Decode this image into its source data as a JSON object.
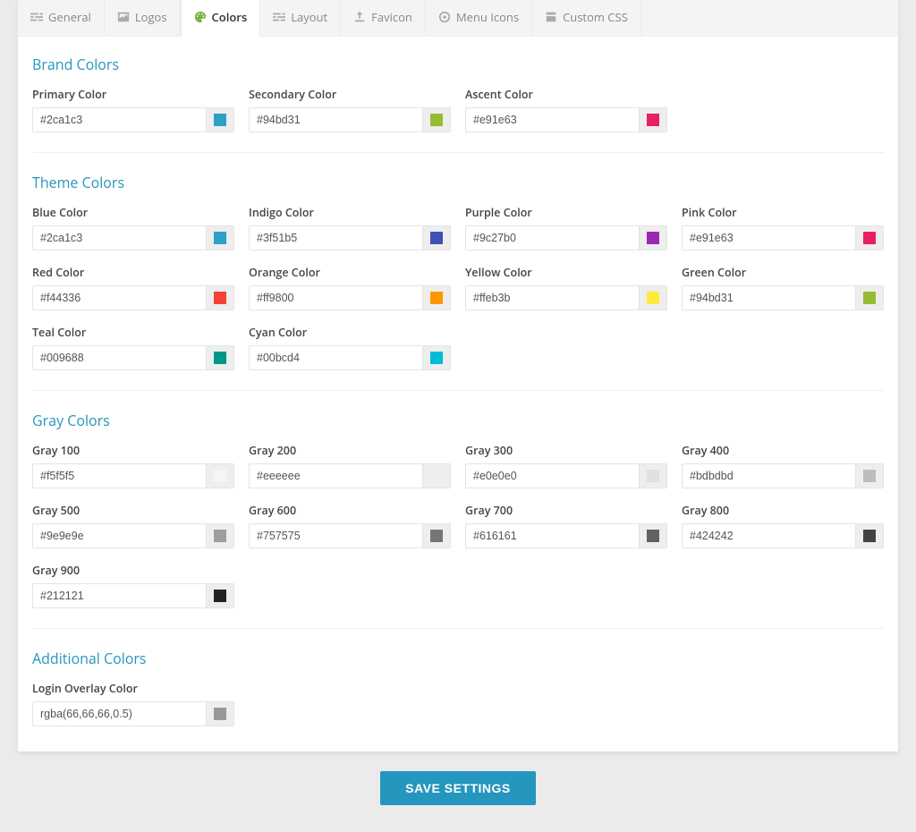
{
  "tabs": [
    {
      "label": "General",
      "icon": "sliders-icon"
    },
    {
      "label": "Logos",
      "icon": "image-icon"
    },
    {
      "label": "Colors",
      "icon": "palette-icon"
    },
    {
      "label": "Layout",
      "icon": "layout-icon"
    },
    {
      "label": "Favicon",
      "icon": "upload-icon"
    },
    {
      "label": "Menu Icons",
      "icon": "record-icon"
    },
    {
      "label": "Custom CSS",
      "icon": "code-icon"
    }
  ],
  "active_tab": "Colors",
  "sections": {
    "brand": {
      "title": "Brand Colors",
      "fields": [
        {
          "label": "Primary Color",
          "value": "#2ca1c3",
          "swatch": "#2ca1c3"
        },
        {
          "label": "Secondary Color",
          "value": "#94bd31",
          "swatch": "#94bd31"
        },
        {
          "label": "Ascent Color",
          "value": "#e91e63",
          "swatch": "#e91e63"
        }
      ]
    },
    "theme": {
      "title": "Theme Colors",
      "fields": [
        {
          "label": "Blue Color",
          "value": "#2ca1c3",
          "swatch": "#2ca1c3"
        },
        {
          "label": "Indigo Color",
          "value": "#3f51b5",
          "swatch": "#3f51b5"
        },
        {
          "label": "Purple Color",
          "value": "#9c27b0",
          "swatch": "#9c27b0"
        },
        {
          "label": "Pink Color",
          "value": "#e91e63",
          "swatch": "#e91e63"
        },
        {
          "label": "Red Color",
          "value": "#f44336",
          "swatch": "#f44336"
        },
        {
          "label": "Orange Color",
          "value": "#ff9800",
          "swatch": "#ff9800"
        },
        {
          "label": "Yellow Color",
          "value": "#ffeb3b",
          "swatch": "#ffeb3b"
        },
        {
          "label": "Green Color",
          "value": "#94bd31",
          "swatch": "#94bd31"
        },
        {
          "label": "Teal Color",
          "value": "#009688",
          "swatch": "#009688"
        },
        {
          "label": "Cyan Color",
          "value": "#00bcd4",
          "swatch": "#00bcd4"
        }
      ]
    },
    "gray": {
      "title": "Gray Colors",
      "fields": [
        {
          "label": "Gray 100",
          "value": "#f5f5f5",
          "swatch": "#f5f5f5"
        },
        {
          "label": "Gray 200",
          "value": "#eeeeee",
          "swatch": "#eeeeee"
        },
        {
          "label": "Gray 300",
          "value": "#e0e0e0",
          "swatch": "#e0e0e0"
        },
        {
          "label": "Gray 400",
          "value": "#bdbdbd",
          "swatch": "#bdbdbd"
        },
        {
          "label": "Gray 500",
          "value": "#9e9e9e",
          "swatch": "#9e9e9e"
        },
        {
          "label": "Gray 600",
          "value": "#757575",
          "swatch": "#757575"
        },
        {
          "label": "Gray 700",
          "value": "#616161",
          "swatch": "#616161"
        },
        {
          "label": "Gray 800",
          "value": "#424242",
          "swatch": "#424242"
        },
        {
          "label": "Gray 900",
          "value": "#212121",
          "swatch": "#212121"
        }
      ]
    },
    "additional": {
      "title": "Additional Colors",
      "fields": [
        {
          "label": "Login Overlay Color",
          "value": "rgba(66,66,66,0.5)",
          "swatch": "rgba(66,66,66,0.5)"
        }
      ]
    }
  },
  "save_button": "SAVE SETTINGS"
}
